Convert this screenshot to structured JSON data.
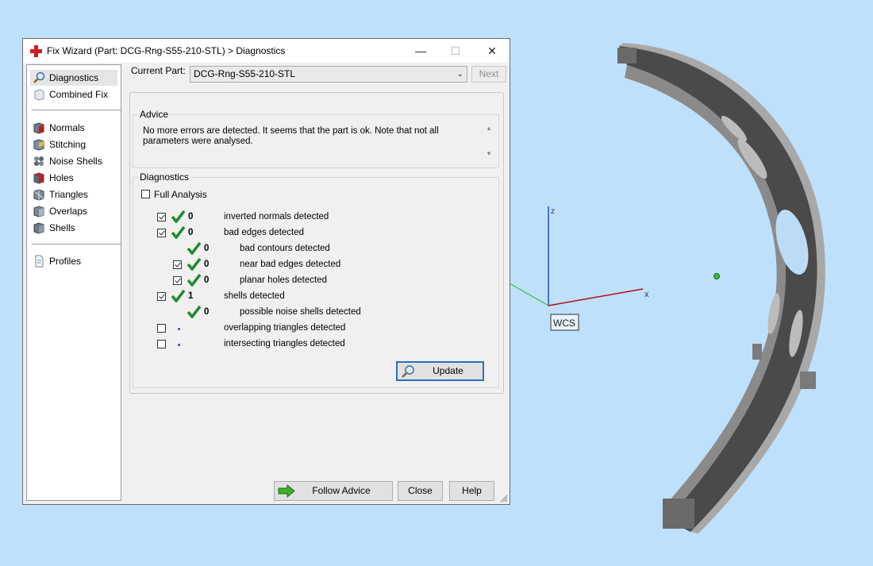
{
  "window": {
    "title": "Fix Wizard (Part: DCG-Rng-S55-210-STL) > Diagnostics",
    "minimize": "—",
    "maximize": "☐",
    "close": "✕"
  },
  "sidebar": {
    "items": [
      {
        "label": "Diagnostics",
        "icon": "magnifier-icon",
        "selected": true
      },
      {
        "label": "Combined Fix",
        "icon": "cube-icon"
      },
      {
        "label": "Normals",
        "icon": "normals-cube-icon"
      },
      {
        "label": "Stitching",
        "icon": "stitching-cube-icon"
      },
      {
        "label": "Noise Shells",
        "icon": "noise-shells-icon"
      },
      {
        "label": "Holes",
        "icon": "holes-cube-icon"
      },
      {
        "label": "Triangles",
        "icon": "triangles-cube-icon"
      },
      {
        "label": "Overlaps",
        "icon": "overlaps-cube-icon"
      },
      {
        "label": "Shells",
        "icon": "shells-cube-icon"
      },
      {
        "label": "Profiles",
        "icon": "document-icon"
      }
    ]
  },
  "main": {
    "current_part_label": "Current Part:",
    "current_part_value": "DCG-Rng-S55-210-STL",
    "next_label": "Next",
    "advice_label": "Advice",
    "advice_text": "No more errors are detected. It seems that the part is ok. Note that not all parameters were analysed.",
    "diagnostics_label": "Diagnostics",
    "full_analysis_label": "Full Analysis",
    "rows": [
      {
        "checkbox": true,
        "checked": true,
        "status": "ok",
        "count": "0",
        "label": "inverted normals detected",
        "indent": 0
      },
      {
        "checkbox": true,
        "checked": true,
        "status": "ok",
        "count": "0",
        "label": "bad edges detected",
        "indent": 0
      },
      {
        "checkbox": false,
        "checked": false,
        "status": "ok",
        "count": "0",
        "label": "bad contours detected",
        "indent": 1
      },
      {
        "checkbox": true,
        "checked": true,
        "status": "ok",
        "count": "0",
        "label": "near bad edges detected",
        "indent": 1
      },
      {
        "checkbox": true,
        "checked": true,
        "status": "ok",
        "count": "0",
        "label": "planar holes detected",
        "indent": 1
      },
      {
        "checkbox": true,
        "checked": true,
        "status": "ok",
        "count": "1",
        "label": "shells detected",
        "indent": 0
      },
      {
        "checkbox": false,
        "checked": false,
        "status": "ok",
        "count": "0",
        "label": "possible noise shells detected",
        "indent": 1
      },
      {
        "checkbox": true,
        "checked": false,
        "status": "pending",
        "count": "",
        "label": "overlapping triangles detected",
        "indent": 0
      },
      {
        "checkbox": true,
        "checked": false,
        "status": "pending",
        "count": "",
        "label": "intersecting triangles detected",
        "indent": 0
      }
    ],
    "update_label": "Update",
    "follow_advice_label": "Follow Advice",
    "close_label": "Close",
    "help_label": "Help"
  },
  "viewport": {
    "axis_z": "z",
    "axis_x": "x",
    "wcs_label": "WCS"
  },
  "colors": {
    "background": "#bfe0fb",
    "tick_green": "#1f8a2a",
    "accent_blue": "#2a6fba"
  }
}
